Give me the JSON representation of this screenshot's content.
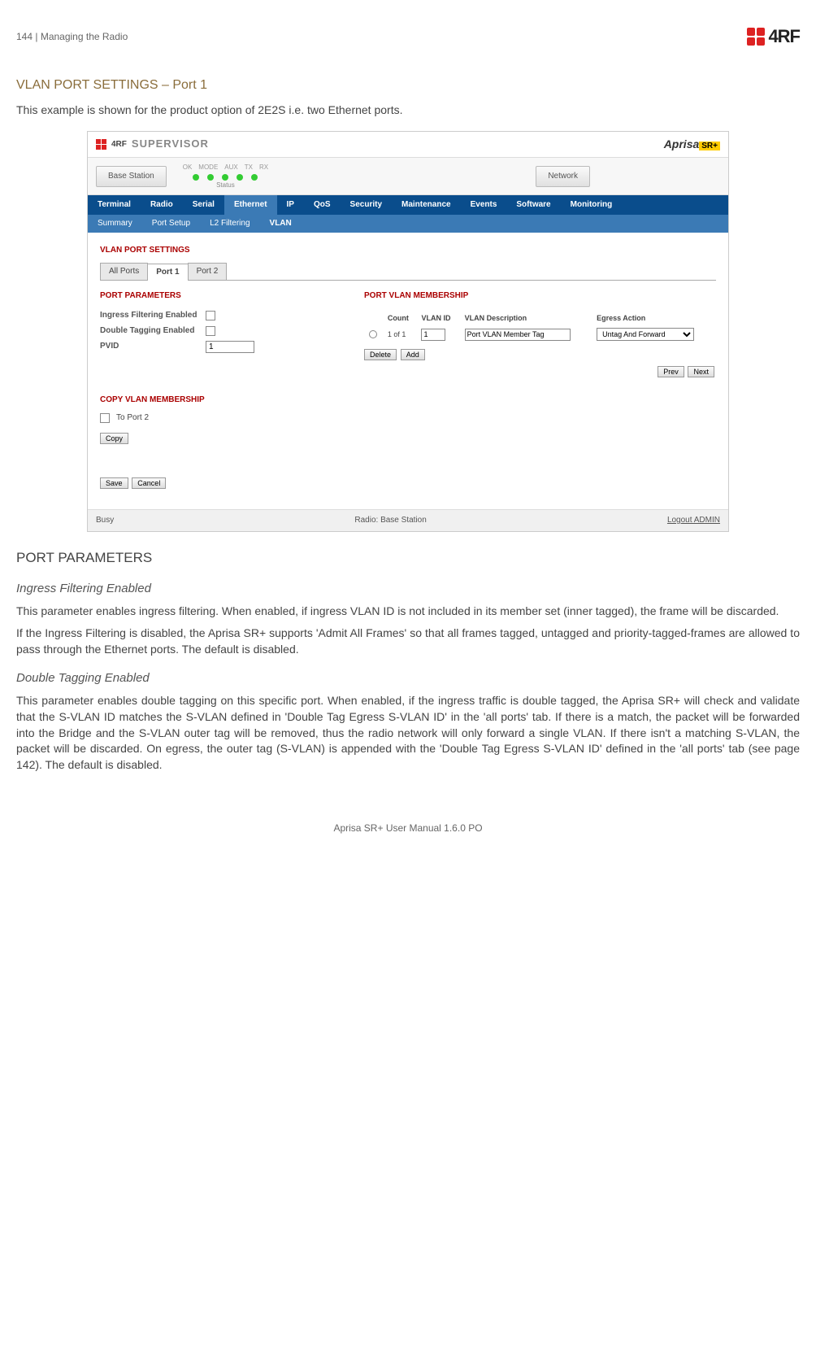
{
  "header": {
    "page_num": "144",
    "section": "Managing the Radio",
    "logo_text": "4RF"
  },
  "title": "VLAN PORT SETTINGS – Port 1",
  "intro": "This example is shown for the product option of 2E2S i.e. two Ethernet ports.",
  "screenshot": {
    "brand": {
      "logo": "4RF",
      "sup": "SUPERVISOR",
      "aprisa": "Aprisa",
      "sr": "SR+"
    },
    "status": {
      "btn1": "Base Station",
      "btn2": "Network",
      "leds": [
        "OK",
        "MODE",
        "AUX",
        "TX",
        "RX"
      ],
      "status_label": "Status"
    },
    "nav": [
      "Terminal",
      "Radio",
      "Serial",
      "Ethernet",
      "IP",
      "QoS",
      "Security",
      "Maintenance",
      "Events",
      "Software",
      "Monitoring"
    ],
    "subnav": [
      "Summary",
      "Port Setup",
      "L2 Filtering",
      "VLAN"
    ],
    "vps_title": "VLAN PORT SETTINGS",
    "tabs": [
      "All Ports",
      "Port 1",
      "Port 2"
    ],
    "port_params": {
      "title": "PORT PARAMETERS",
      "rows": [
        {
          "label": "Ingress Filtering Enabled",
          "type": "checkbox"
        },
        {
          "label": "Double Tagging Enabled",
          "type": "checkbox"
        },
        {
          "label": "PVID",
          "type": "text",
          "value": "1"
        }
      ]
    },
    "membership": {
      "title": "PORT VLAN MEMBERSHIP",
      "cols": [
        "Count",
        "VLAN ID",
        "VLAN Description",
        "Egress Action"
      ],
      "row": {
        "count": "1 of 1",
        "vid": "1",
        "desc": "Port VLAN Member Tag",
        "action": "Untag And Forward"
      },
      "btns": {
        "del": "Delete",
        "add": "Add",
        "prev": "Prev",
        "next": "Next"
      }
    },
    "copy": {
      "title": "COPY VLAN MEMBERSHIP",
      "to": "To Port 2",
      "btn": "Copy"
    },
    "save": {
      "save": "Save",
      "cancel": "Cancel"
    },
    "footer": {
      "left": "Busy",
      "mid": "Radio: Base Station",
      "right": "Logout ADMIN"
    }
  },
  "params_heading": "PORT PARAMETERS",
  "ing": {
    "title": "Ingress Filtering Enabled",
    "p1": "This parameter enables ingress filtering. When enabled, if ingress VLAN ID is not included in its member set (inner tagged), the frame will be discarded.",
    "p2": "If the Ingress Filtering is disabled, the Aprisa SR+ supports 'Admit All Frames' so that all frames tagged, untagged and priority-tagged-frames are allowed to pass through the Ethernet ports. The default is disabled."
  },
  "dbl": {
    "title": "Double Tagging Enabled",
    "p1": "This parameter enables double tagging on this specific port. When enabled, if the ingress traffic is double tagged, the Aprisa SR+ will check and validate that the S-VLAN ID matches the S-VLAN defined in 'Double Tag Egress S-VLAN ID' in the 'all ports' tab. If there is a match, the packet will be forwarded into the Bridge and the S-VLAN outer tag will be removed, thus the radio network will only forward a single VLAN. If there isn't a matching S-VLAN, the packet will be discarded. On egress, the outer tag (S-VLAN) is appended with the 'Double Tag Egress S-VLAN ID' defined in the 'all ports' tab (see page 142). The default is disabled."
  },
  "footer_text": "Aprisa SR+ User Manual 1.6.0 PO"
}
